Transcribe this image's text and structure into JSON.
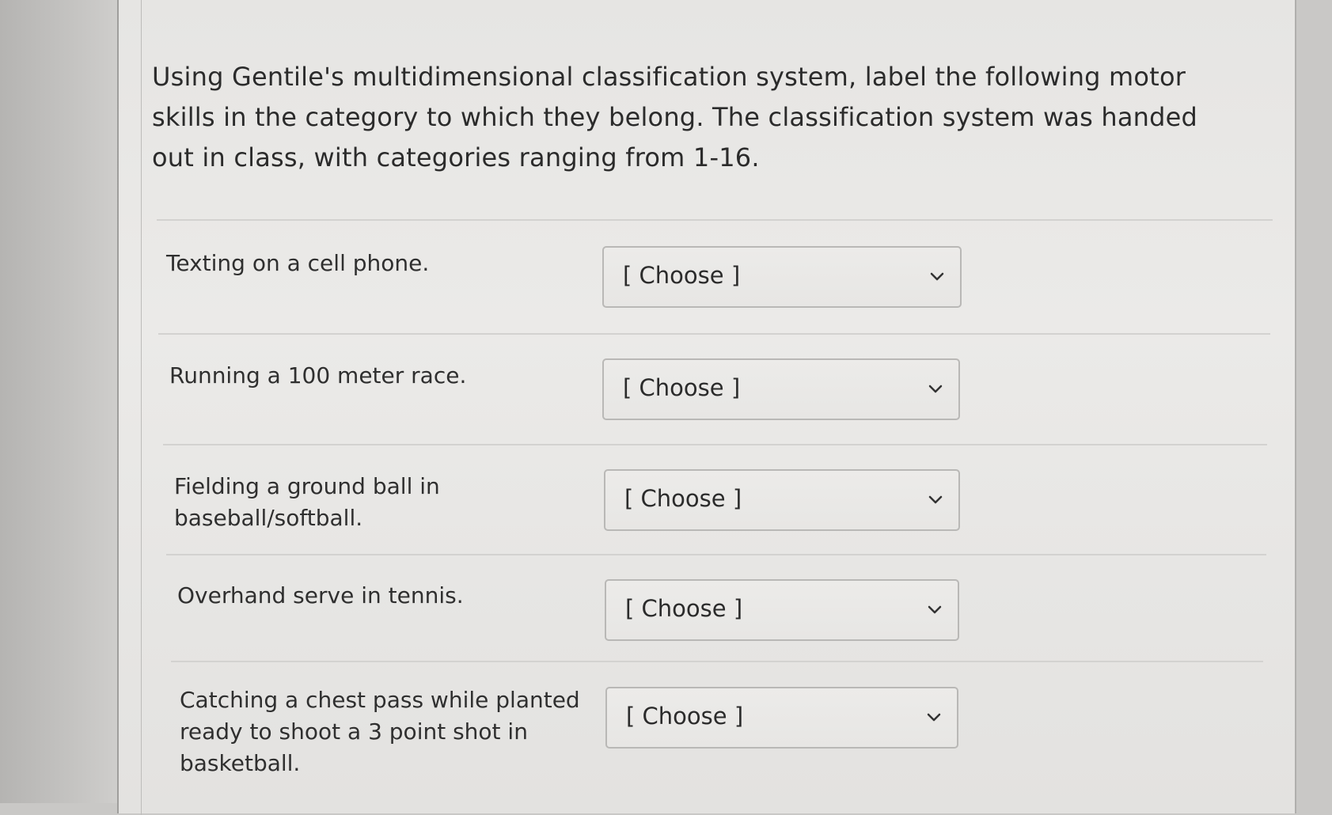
{
  "question": {
    "prompt": "Using Gentile's multidimensional classification system, label the following motor skills in the category to which they belong. The classification system was handed out in class, with categories ranging from 1-16."
  },
  "items": [
    {
      "label": "Texting on a cell phone.",
      "selected": "[ Choose ]"
    },
    {
      "label": "Running a 100 meter race.",
      "selected": "[ Choose ]"
    },
    {
      "label": "Fielding a ground ball in baseball/softball.",
      "selected": "[ Choose ]"
    },
    {
      "label": "Overhand serve in tennis.",
      "selected": "[ Choose ]"
    },
    {
      "label": "Catching a chest pass while planted ready to shoot a 3 point shot in basketball.",
      "selected": "[ Choose ]"
    }
  ],
  "icons": {
    "dropdown": "chevron-down-icon"
  }
}
